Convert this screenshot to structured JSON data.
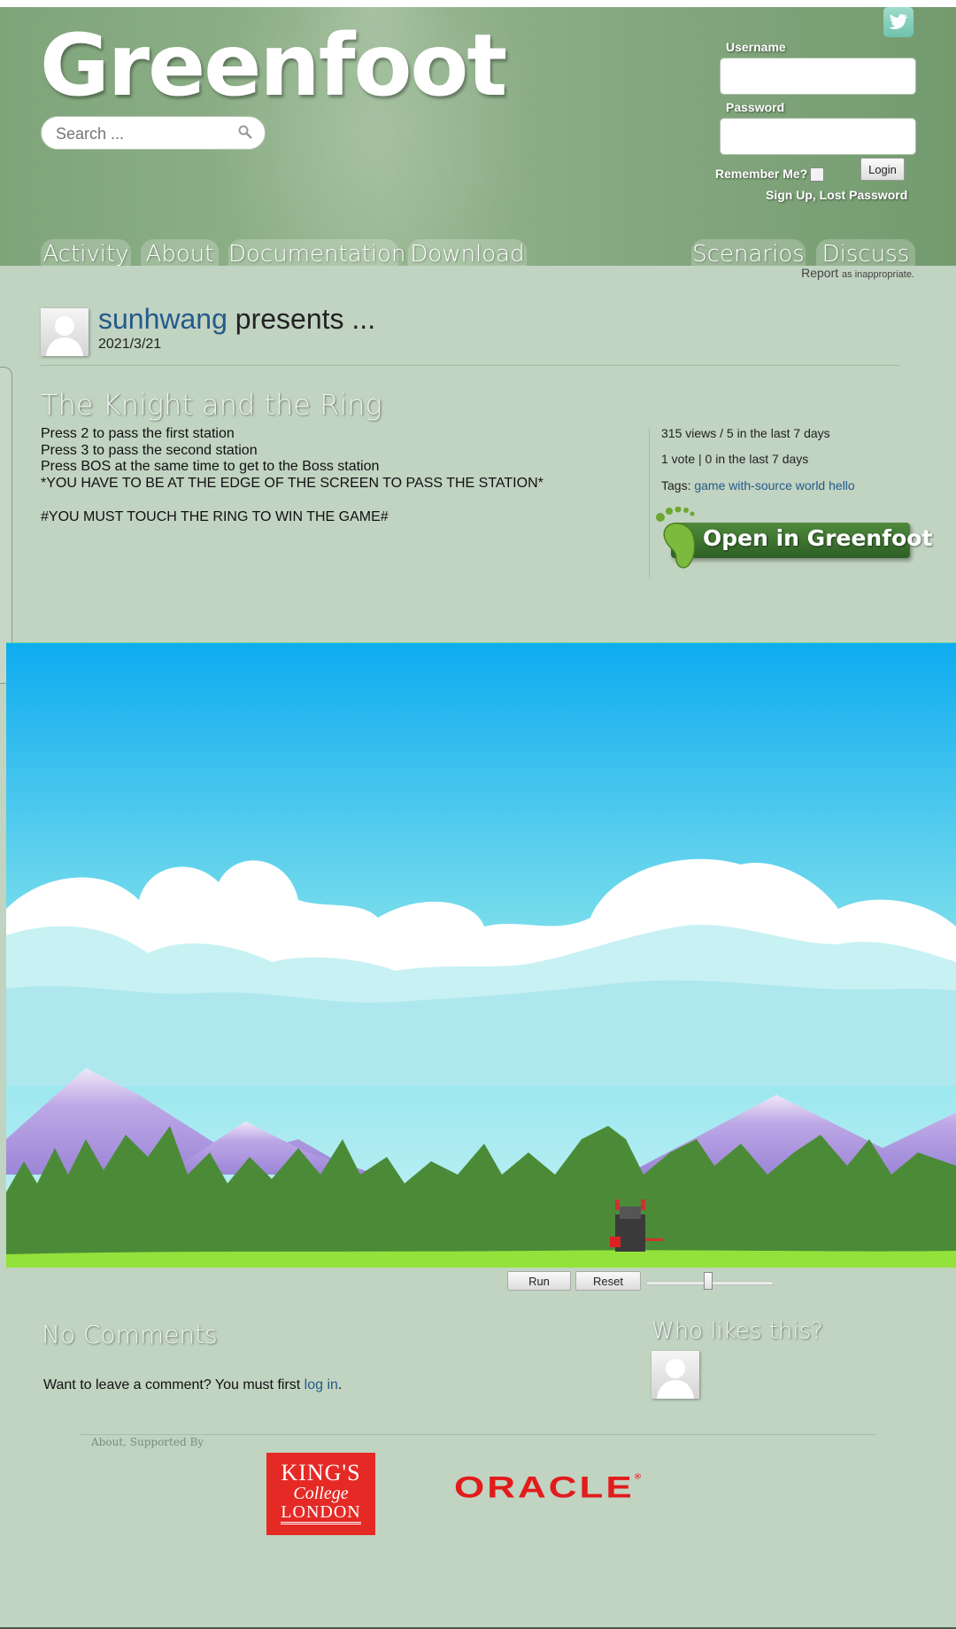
{
  "site": {
    "logo": "Greenfoot",
    "search_placeholder": "Search ...",
    "twitter_icon": "twitter-icon"
  },
  "login": {
    "username_label": "Username",
    "password_label": "Password",
    "remember_label": "Remember Me?",
    "login_button": "Login",
    "signup_text": "Sign Up, Lost Password"
  },
  "nav": {
    "left": [
      "Activity",
      "About",
      "Documentation",
      "Download"
    ],
    "right": [
      "Scenarios",
      "Discuss"
    ]
  },
  "report": {
    "link": "Report",
    "suffix": "as inappropriate."
  },
  "scenario": {
    "author": "sunhwang",
    "presents": " presents ...",
    "date": "2021/3/21",
    "title": "The Knight and the Ring",
    "description": "Press 2 to pass the first station\nPress 3 to pass the second station\nPress BOS at the same time to get to the Boss station\n*YOU HAVE TO BE AT THE EDGE OF THE SCREEN TO PASS THE STATION*\n\n#YOU MUST TOUCH THE RING TO WIN THE GAME#",
    "views": "315 views / 5 in the last 7 days",
    "votes": "1 vote | 0 in the last 7 days",
    "tags_label": "Tags:",
    "tags": [
      "game",
      "with-source",
      "world",
      "hello"
    ],
    "open_button": "Open in Greenfoot"
  },
  "controls": {
    "run": "Run",
    "reset": "Reset",
    "speed": 0.5
  },
  "comments": {
    "heading": "No Comments",
    "prompt": "Want to leave a comment? You must first ",
    "login_link": "log in",
    "prompt_end": "."
  },
  "likes": {
    "heading": "Who likes this?"
  },
  "footer": {
    "supported": "About, Supported By",
    "kings": [
      "KING'S",
      "College",
      "LONDON"
    ],
    "oracle": "ORACLE",
    "oracle_mark": "®"
  },
  "colors": {
    "background": "#c1d3c1",
    "header": "#84a67f",
    "link": "#245a8c",
    "button_green": "#3b7430",
    "kings_red": "#e52a26",
    "oracle_red": "#e21b1b"
  }
}
